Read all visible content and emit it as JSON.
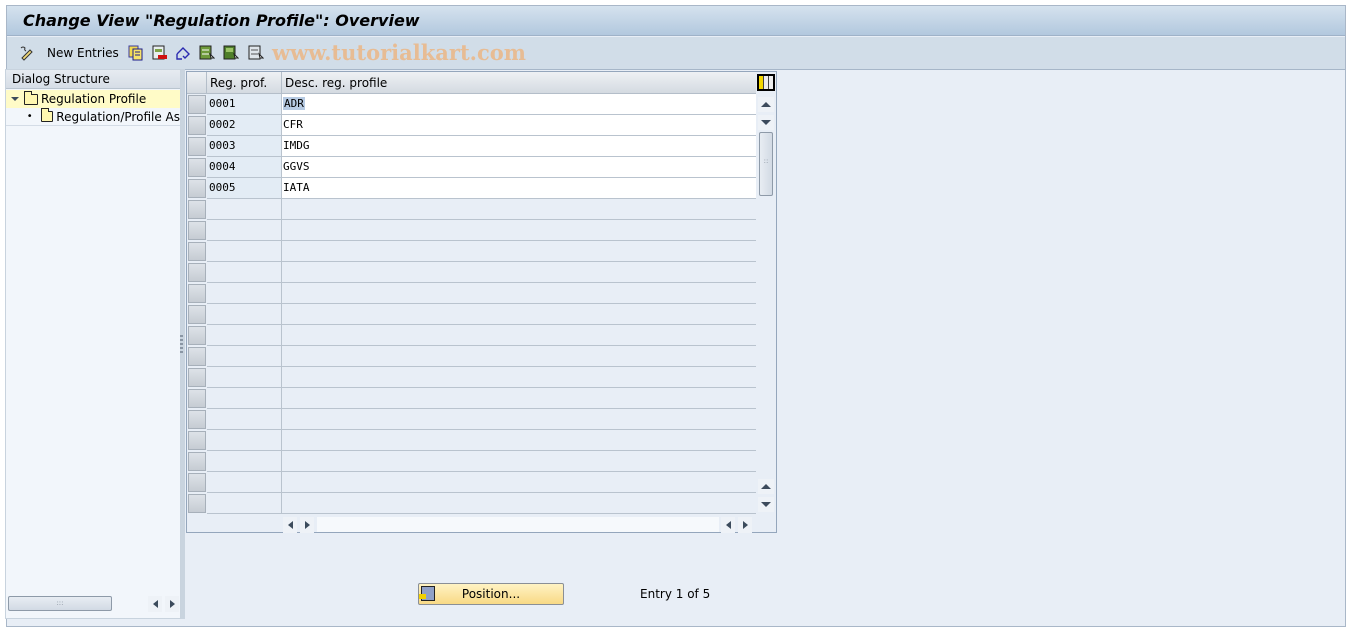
{
  "window": {
    "title": "Change View \"Regulation Profile\": Overview"
  },
  "toolbar": {
    "new_entries_label": "New Entries",
    "icons": [
      "edit-toggle-icon",
      "copy-as-icon",
      "delete-icon",
      "undo-change-icon",
      "select-all-icon",
      "select-block-icon",
      "deselect-all-icon"
    ],
    "watermark": "www.tutorialkart.com"
  },
  "tree": {
    "header": "Dialog Structure",
    "items": [
      {
        "label": "Regulation Profile",
        "expanded": true,
        "selected": true
      },
      {
        "label": "Regulation/Profile As",
        "expanded": false,
        "selected": false
      }
    ]
  },
  "table": {
    "columns": [
      "Reg. prof.",
      "Desc. reg. profile"
    ],
    "rows": [
      {
        "reg_prof": "0001",
        "desc": "ADR"
      },
      {
        "reg_prof": "0002",
        "desc": "CFR"
      },
      {
        "reg_prof": "0003",
        "desc": "IMDG"
      },
      {
        "reg_prof": "0004",
        "desc": "GGVS"
      },
      {
        "reg_prof": "0005",
        "desc": "IATA"
      }
    ],
    "empty_rows": 15
  },
  "footer": {
    "position_label": "Position...",
    "entry_text": "Entry 1 of 5"
  }
}
